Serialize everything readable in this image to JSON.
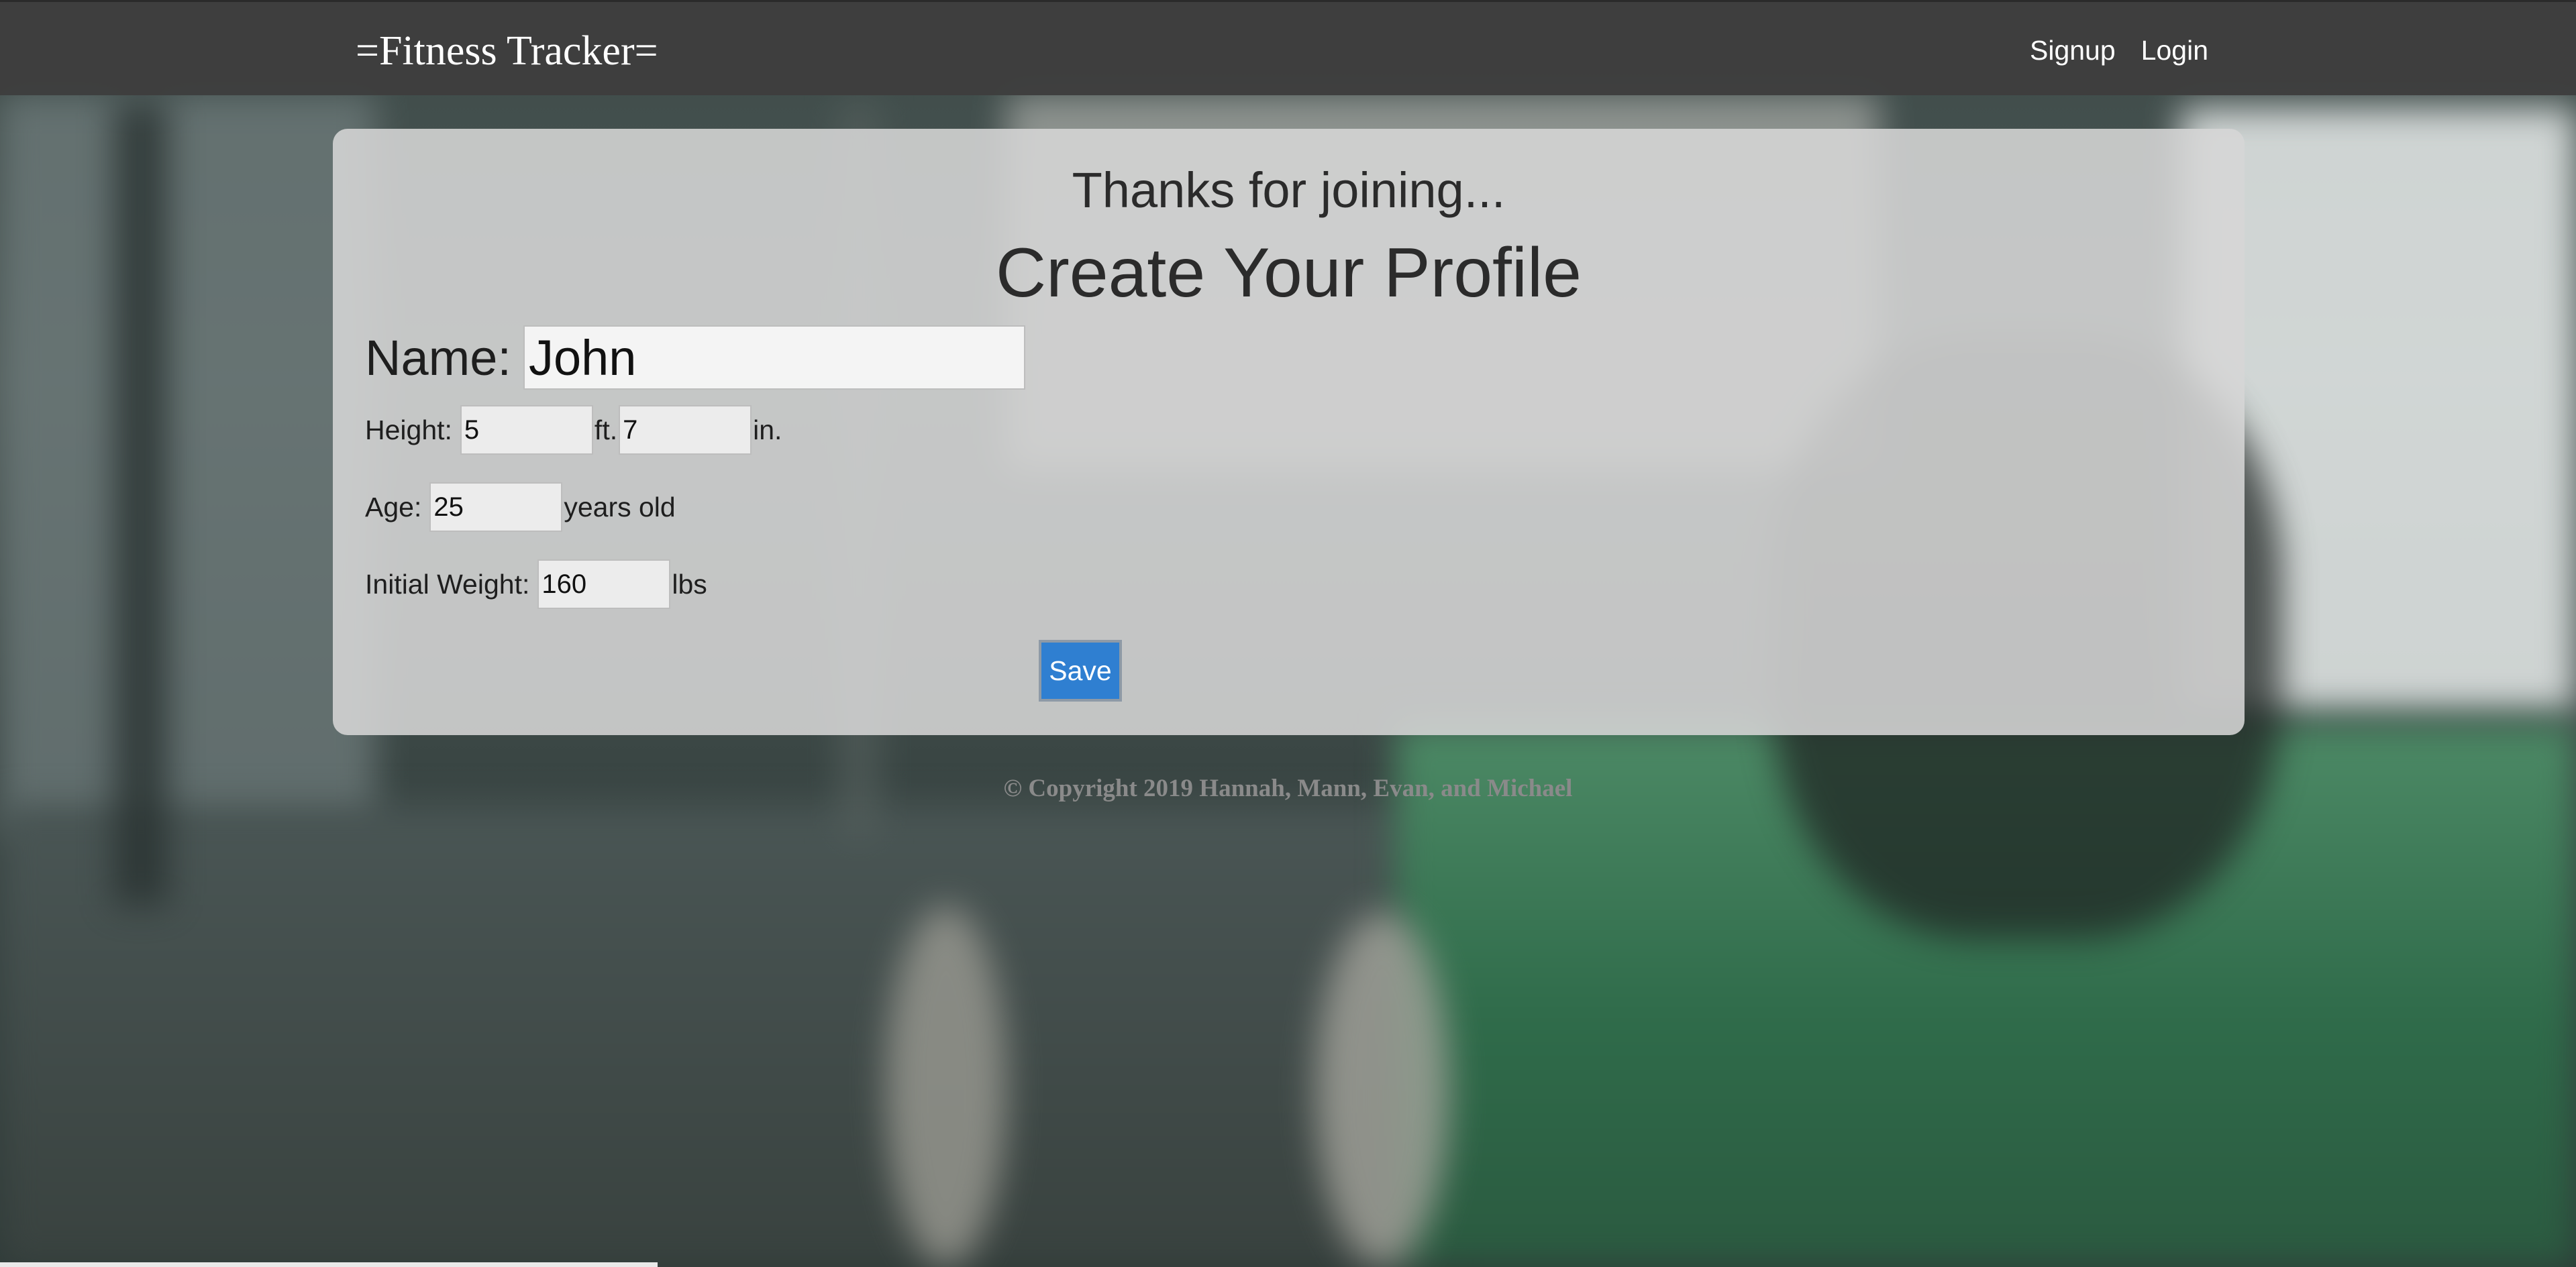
{
  "navbar": {
    "brand": "=Fitness Tracker=",
    "links": [
      "Signup",
      "Login"
    ]
  },
  "card": {
    "subtitle": "Thanks for joining...",
    "title": "Create Your Profile"
  },
  "form": {
    "name": {
      "label": "Name:",
      "value": "John"
    },
    "height": {
      "label": "Height:",
      "feet": "5",
      "feet_unit": "ft.",
      "inches": "7",
      "inches_unit": "in."
    },
    "age": {
      "label": "Age:",
      "value": "25",
      "unit": "years old"
    },
    "weight": {
      "label": "Initial Weight:",
      "value": "160",
      "unit": "lbs"
    },
    "save_label": "Save"
  },
  "footer": {
    "copyright": "© Copyright 2019 Hannah, Mann, Evan, and Michael"
  }
}
